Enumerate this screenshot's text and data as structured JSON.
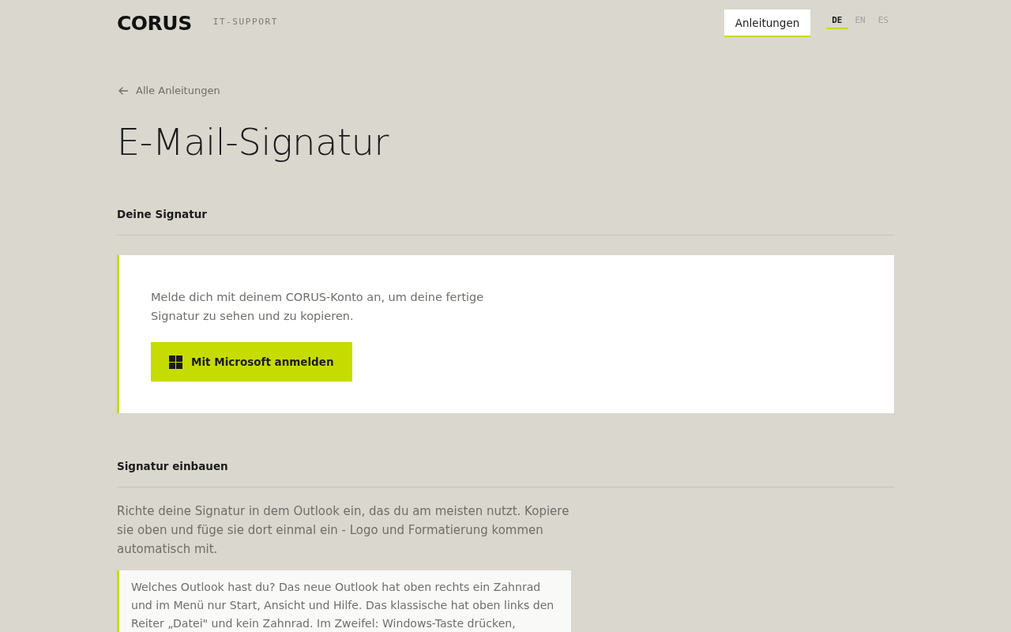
{
  "header": {
    "logo": "CORUS",
    "subtitle": "IT-SUPPORT",
    "nav": [
      {
        "label": "Anleitungen",
        "selected": true
      }
    ],
    "languages": [
      {
        "label": "DE",
        "selected": true
      },
      {
        "label": "EN",
        "selected": false
      },
      {
        "label": "ES",
        "selected": false
      }
    ]
  },
  "back_link": {
    "label": "Alle Anleitungen"
  },
  "title": "E-Mail-Signatur",
  "sections": [
    {
      "kind": "login",
      "heading": "Deine Signatur",
      "text": "Melde dich mit deinem CORUS-Konto an, um deine fertige Signatur zu sehen und zu kopieren.",
      "button": "Mit Microsoft anmelden"
    },
    {
      "kind": "guide",
      "heading": "Signatur einbauen",
      "text": "Richte deine Signatur in dem Outlook ein, das du am meisten nutzt. Kopiere sie oben und füge sie dort einmal ein - Logo und Formatierung kommen automatisch mit.",
      "note": "Welches Outlook hast du? Das neue Outlook hat oben rechts ein Zahnrad und im Menü nur Start, Ansicht und Hilfe. Das klassische hat oben links den Reiter „Datei\" und kein Zahnrad. Im Zweifel: Windows-Taste drücken,"
    }
  ]
}
